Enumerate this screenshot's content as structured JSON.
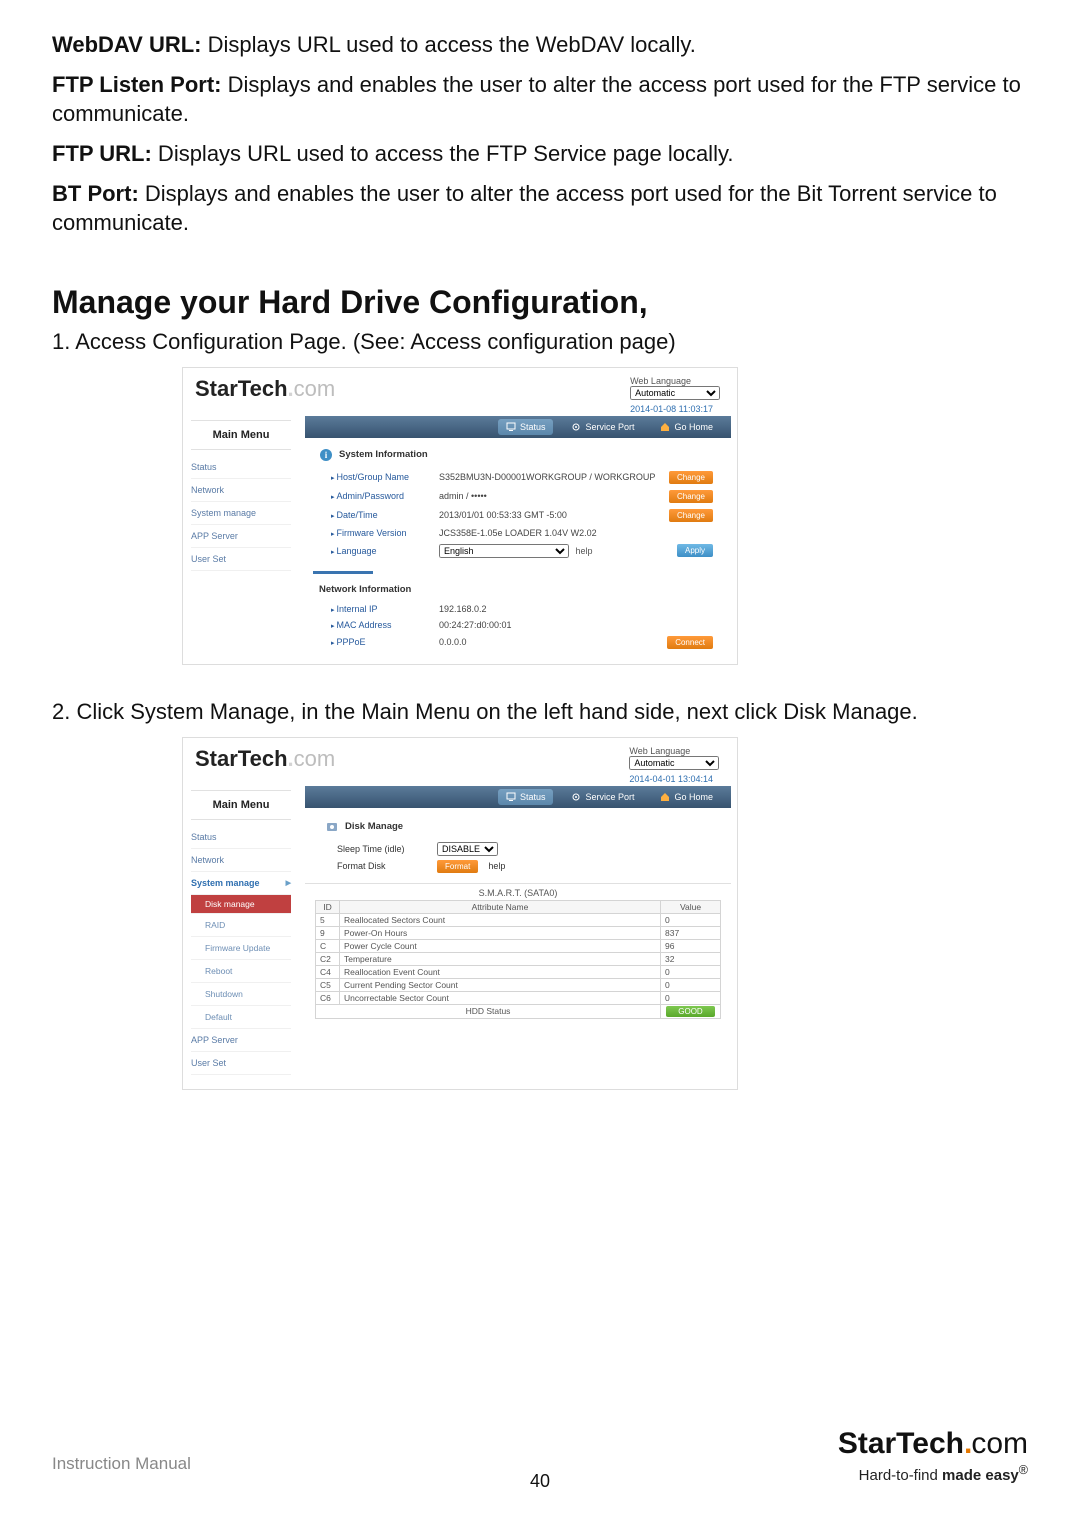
{
  "intro": {
    "webdav_label": "WebDAV URL:",
    "webdav_text": " Displays URL used to access the WebDAV locally.",
    "ftpport_label": "FTP Listen Port:",
    "ftpport_text": " Displays and enables the user to alter the access port used for the FTP service to communicate.",
    "ftpurl_label": "FTP URL:",
    "ftpurl_text": " Displays URL used to access the FTP Service page locally.",
    "btport_label": "BT Port:",
    "btport_text": " Displays and enables the user to alter the access port used for the Bit Torrent service to communicate."
  },
  "heading": "Manage your Hard Drive Configuration,",
  "steps": {
    "one": "1.  Access Configuration Page. (See: Access configuration page)",
    "two": "2.  Click System Manage, in the Main Menu on the left hand side, next click Disk Manage."
  },
  "shot1": {
    "brand": "StarTech",
    "brandcom": "com",
    "lang_label": "Web Language",
    "lang_value": "Automatic",
    "timestamp": "2014-01-08 11:03:17",
    "menu_head": "Main Menu",
    "menu": {
      "i0": "Status",
      "i1": "Network",
      "i2": "System manage",
      "i3": "APP Server",
      "i4": "User Set"
    },
    "tabs": {
      "status": "Status",
      "service": "Service Port",
      "home": "Go Home"
    },
    "sect_sys": "System Information",
    "rows": {
      "r0l": "Host/Group Name",
      "r0v": "S352BMU3N-D00001WORKGROUP / WORKGROUP",
      "r0b": "Change",
      "r1l": "Admin/Password",
      "r1v": "admin / •••••",
      "r1b": "Change",
      "r2l": "Date/Time",
      "r2v": "2013/01/01 00:53:33 GMT -5:00",
      "r2b": "Change",
      "r3l": "Firmware Version",
      "r3v": "JCS358E-1.05e LOADER 1.04V W2.02",
      "r4l": "Language",
      "r4v": "English",
      "r4h": "help",
      "r4b": "Apply"
    },
    "sect_net": "Network Information",
    "net": {
      "n0l": "Internal IP",
      "n0v": "192.168.0.2",
      "n1l": "MAC Address",
      "n1v": "00:24:27:d0:00:01",
      "n2l": "PPPoE",
      "n2v": "0.0.0.0",
      "n2b": "Connect"
    }
  },
  "shot2": {
    "brand": "StarTech",
    "brandcom": "com",
    "lang_label": "Web Language",
    "lang_value": "Automatic",
    "timestamp": "2014-04-01 13:04:14",
    "menu_head": "Main Menu",
    "menu": {
      "i0": "Status",
      "i1": "Network",
      "i2": "System manage",
      "s0": "Disk manage",
      "s1": "RAID",
      "s2": "Firmware Update",
      "s3": "Reboot",
      "s4": "Shutdown",
      "s5": "Default",
      "i3": "APP Server",
      "i4": "User Set"
    },
    "tabs": {
      "status": "Status",
      "service": "Service Port",
      "home": "Go Home"
    },
    "dm_title": "Disk Manage",
    "sleep_label": "Sleep Time (idle)",
    "sleep_value": "DISABLE",
    "format_label": "Format Disk",
    "format_btn": "Format",
    "format_help": "help",
    "smart_caption": "S.M.A.R.T. (SATA0)",
    "th_id": "ID",
    "th_attr": "Attribute Name",
    "th_val": "Value",
    "rows": [
      {
        "id": "5",
        "name": "Reallocated Sectors Count",
        "val": "0"
      },
      {
        "id": "9",
        "name": "Power-On Hours",
        "val": "837"
      },
      {
        "id": "C",
        "name": "Power Cycle Count",
        "val": "96"
      },
      {
        "id": "C2",
        "name": "Temperature",
        "val": "32"
      },
      {
        "id": "C4",
        "name": "Reallocation Event Count",
        "val": "0"
      },
      {
        "id": "C5",
        "name": "Current Pending Sector Count",
        "val": "0"
      },
      {
        "id": "C6",
        "name": "Uncorrectable Sector Count",
        "val": "0"
      }
    ],
    "hdd_status_label": "HDD Status",
    "hdd_status_value": "GOOD"
  },
  "footer": {
    "label": "Instruction Manual",
    "page": "40",
    "brand": "StarTech",
    "brandcom": "com",
    "tagline_a": "Hard-to-find ",
    "tagline_b": "made easy"
  }
}
